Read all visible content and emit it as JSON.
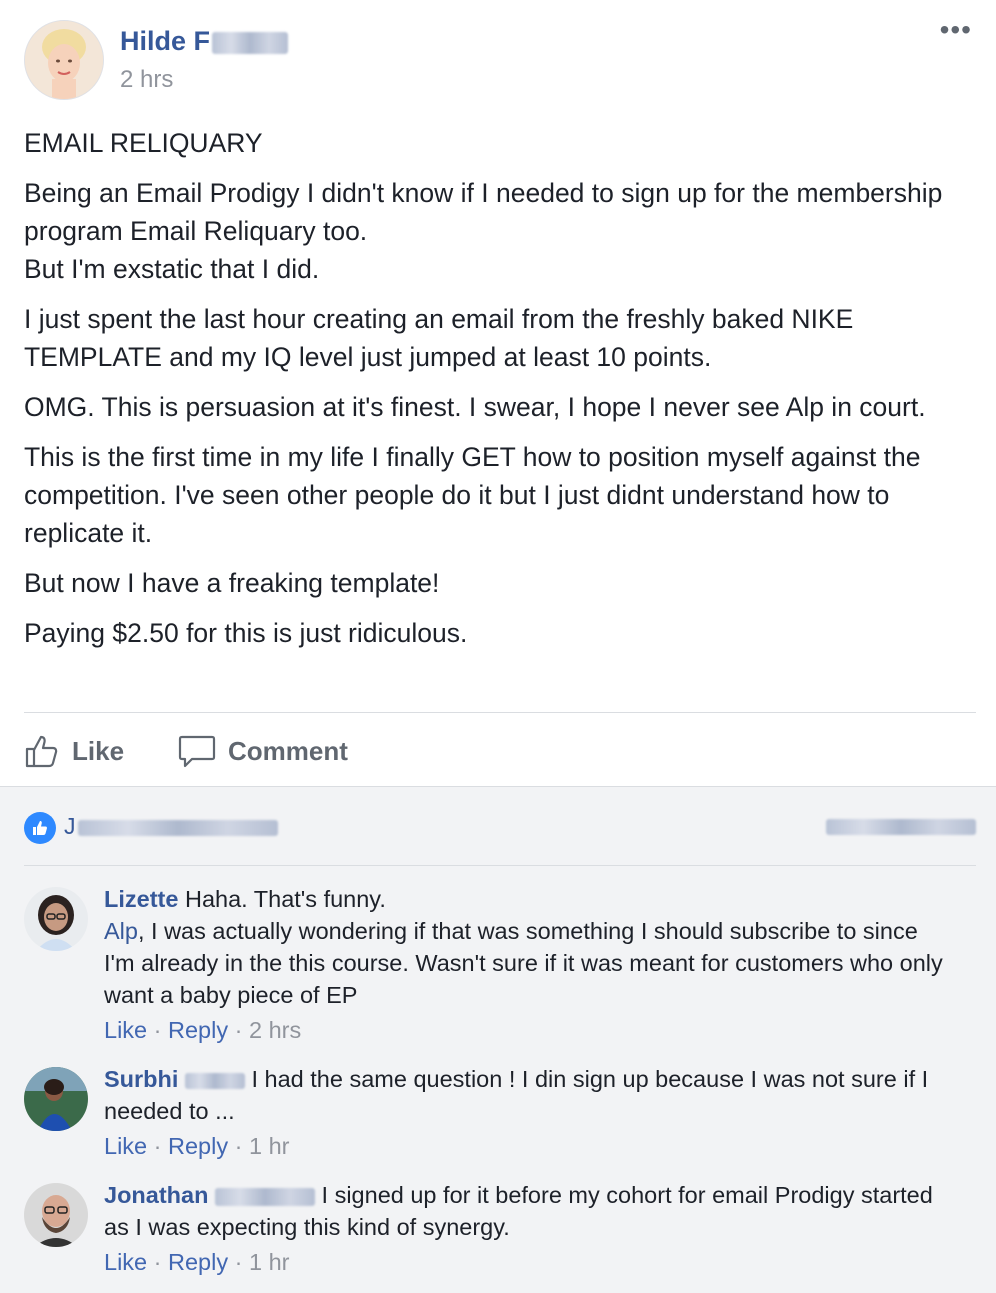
{
  "post": {
    "author": "Hilde F",
    "time": "2 hrs",
    "more": "•••",
    "paragraphs": [
      "EMAIL RELIQUARY",
      "Being an Email Prodigy I didn't know if I needed to sign up for the membership program Email Reliquary too.\nBut I'm exstatic that I did.",
      "I just spent the last hour creating an email from the freshly baked NIKE TEMPLATE and my IQ level just jumped at least 10 points.",
      "OMG. This is persuasion at it's finest. I swear, I hope I never see Alp in court.",
      "This is the first time in my life I finally GET how to position myself against the competition. I've seen other people do it but I just didnt understand how to replicate it.",
      "But now I have a freaking template!",
      "Paying $2.50 for this is just ridiculous."
    ]
  },
  "actions": {
    "like": "Like",
    "comment": "Comment"
  },
  "reactions": {
    "names_prefix": "J"
  },
  "comments": [
    {
      "name": "Lizette",
      "line1": "Haha. That's funny.",
      "mention": "Alp",
      "text": ", I was actually wondering if that was something I should subscribe to since I'm already in the this course. Wasn't sure if it was meant for customers who only want a baby piece of EP",
      "like": "Like",
      "reply": "Reply",
      "time": "2 hrs"
    },
    {
      "name": "Surbhi",
      "text": "I had the same question ! I din sign up because I was not sure if I needed to ...",
      "like": "Like",
      "reply": "Reply",
      "time": "1 hr"
    },
    {
      "name": "Jonathan",
      "text": "I signed up for it before my cohort for email Prodigy started as I was expecting this kind of synergy.",
      "like": "Like",
      "reply": "Reply",
      "time": "1 hr"
    }
  ],
  "meta_separator": "·",
  "icons": [
    "avatar",
    "more-options-icon",
    "thumbs-up-icon",
    "comment-bubble-icon",
    "like-reaction-icon"
  ],
  "colors": {
    "link": "#365899",
    "meta": "#90949c",
    "action": "#606770",
    "like_blue": "#2e89ff",
    "comments_bg": "#f2f3f5"
  }
}
